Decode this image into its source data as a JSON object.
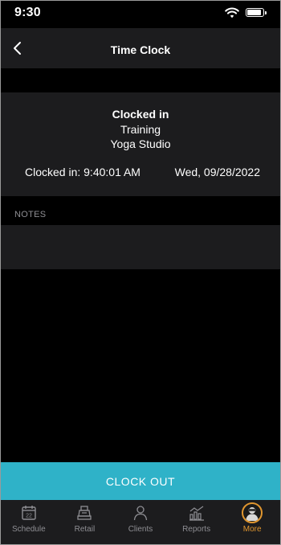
{
  "status_bar": {
    "time": "9:30"
  },
  "nav": {
    "title": "Time Clock",
    "back_icon": "chevron-left-icon"
  },
  "card": {
    "status": "Clocked in",
    "class_name": "Training",
    "location": "Yoga Studio",
    "clocked_in_time": "Clocked in: 9:40:01 AM",
    "date": "Wed, 09/28/2022"
  },
  "notes": {
    "label": "NOTES",
    "value": ""
  },
  "clock_out": {
    "label": "CLOCK OUT"
  },
  "tabs": [
    {
      "label": "Schedule",
      "icon": "calendar-icon",
      "badge": "22"
    },
    {
      "label": "Retail",
      "icon": "register-icon"
    },
    {
      "label": "Clients",
      "icon": "person-icon"
    },
    {
      "label": "Reports",
      "icon": "bar-chart-icon"
    },
    {
      "label": "More",
      "icon": "avatar-icon",
      "active": true
    }
  ],
  "colors": {
    "accent": "#2fb2c8",
    "active_tab": "#e0962f",
    "background": "#000000",
    "surface": "#1c1c1e"
  }
}
